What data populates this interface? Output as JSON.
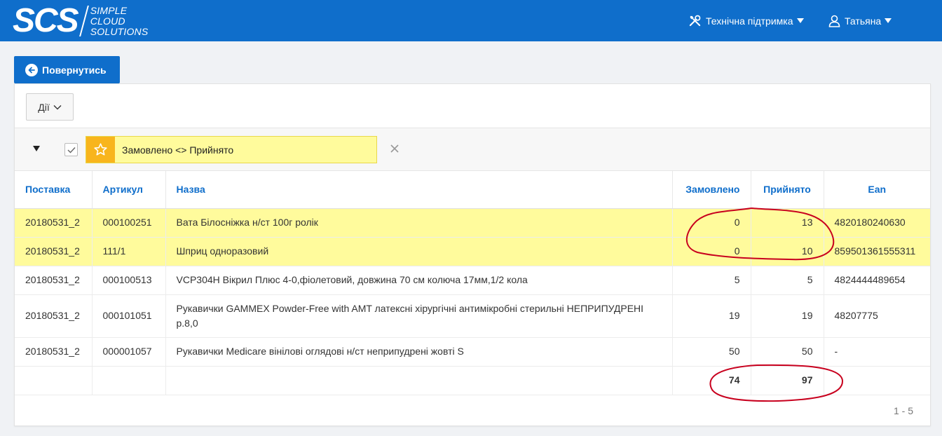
{
  "brand": {
    "logo_main": "SCS",
    "logo_words": [
      "SIMPLE",
      "CLOUD",
      "SOLUTIONS"
    ]
  },
  "nav": {
    "support_label": "Технічна підтримка",
    "user_label": "Татьяна",
    "support_icon": "tools-icon",
    "user_icon": "user-icon"
  },
  "back_button": {
    "label": "Повернутись"
  },
  "actions": {
    "label": "Дії"
  },
  "filter": {
    "label": "Замовлено <> Прийнято",
    "enabled": true
  },
  "table": {
    "headers": [
      "Поставка",
      "Артикул",
      "Назва",
      "Замовлено",
      "Прийнято",
      "Ean"
    ],
    "rows": [
      {
        "delivery": "20180531_2",
        "article": "000100251",
        "name": "Вата Білосніжка н/ст 100г ролік",
        "ordered": "0",
        "received": "13",
        "ean": "4820180240630",
        "highlight": true
      },
      {
        "delivery": "20180531_2",
        "article": "111/1",
        "name": "Шприц одноразовий",
        "ordered": "0",
        "received": "10",
        "ean": "859501361555311",
        "highlight": true
      },
      {
        "delivery": "20180531_2",
        "article": "000100513",
        "name": "VCP304H Вікрил Плюс 4-0,фіолетовий, довжина 70 см колюча 17мм,1/2 кола",
        "ordered": "5",
        "received": "5",
        "ean": "4824444489654",
        "highlight": false
      },
      {
        "delivery": "20180531_2",
        "article": "000101051",
        "name": "Рукавички GAMMEX Powder-Free with AMT латексні хірургічні антимікробні стерильні НЕПРИПУДРЕНІ р.8,0",
        "ordered": "19",
        "received": "19",
        "ean": "48207775",
        "highlight": false
      },
      {
        "delivery": "20180531_2",
        "article": "000001057",
        "name": "Рукавички Medicare вінілові оглядові н/ст неприпудрені жовті S",
        "ordered": "50",
        "received": "50",
        "ean": "-",
        "highlight": false
      }
    ],
    "totals": {
      "ordered": "74",
      "received": "97"
    }
  },
  "pagination": {
    "range": "1 - 5"
  },
  "colors": {
    "brand_blue": "#0f6ecb",
    "highlight_yellow": "#fffb9c",
    "chip_orange": "#f8b51d",
    "annotation_red": "#c8001e"
  }
}
